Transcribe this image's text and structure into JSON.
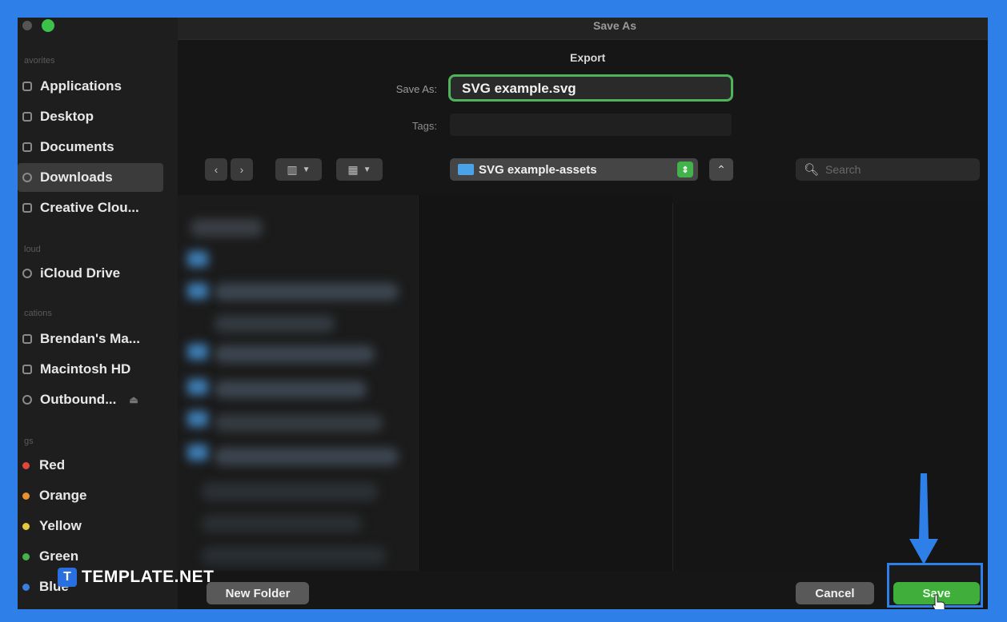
{
  "dialog": {
    "title": "Save As",
    "section_label": "Export",
    "save_as_label": "Save As:",
    "save_as_value": "SVG example.svg",
    "tags_label": "Tags:",
    "tags_value": ""
  },
  "sidebar": {
    "favorites_header": "avorites",
    "favorites": [
      {
        "label": "Applications"
      },
      {
        "label": "Desktop"
      },
      {
        "label": "Documents"
      },
      {
        "label": "Downloads",
        "selected": true
      },
      {
        "label": "Creative Clou..."
      }
    ],
    "icloud_header": "loud",
    "icloud": [
      {
        "label": "iCloud Drive"
      }
    ],
    "locations_header": "cations",
    "locations": [
      {
        "label": "Brendan's Ma..."
      },
      {
        "label": "Macintosh HD"
      },
      {
        "label": "Outbound..."
      }
    ],
    "tags_header": "gs",
    "tags": [
      {
        "label": "Red",
        "color": "#e0463c"
      },
      {
        "label": "Orange",
        "color": "#e8912e"
      },
      {
        "label": "Yellow",
        "color": "#e6c93a"
      },
      {
        "label": "Green",
        "color": "#47b44a"
      },
      {
        "label": "Blue",
        "color": "#3a7fe0"
      }
    ]
  },
  "toolbar": {
    "location": "SVG example-assets",
    "search_placeholder": "Search"
  },
  "buttons": {
    "new_folder": "New Folder",
    "cancel": "Cancel",
    "save": "Save"
  },
  "watermark": {
    "logo_letter": "T",
    "text": "TEMPLATE.NET"
  },
  "colors": {
    "highlight": "#2f7fe8",
    "save_button": "#3fae3a",
    "focus_ring": "#4fb35a"
  }
}
